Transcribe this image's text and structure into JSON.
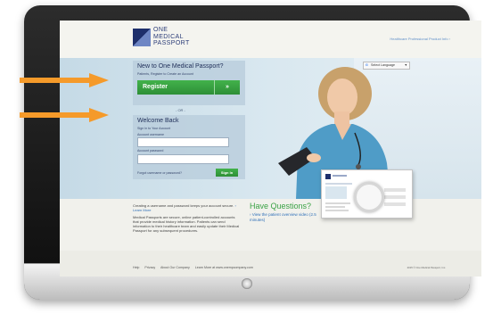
{
  "header": {
    "logo_text": "ONE\nMEDICAL\nPASSPORT",
    "pro_link": "Healthcare Professional Product Info ›"
  },
  "language": {
    "label": "Select Language",
    "caret": "▼",
    "g_icon": "G"
  },
  "new_section": {
    "title": "New to One Medical Passport?",
    "subtitle": "Patients, Register to Create an Account",
    "register_label": "Register",
    "register_chevron": "»"
  },
  "or_label": "- OR -",
  "welcome": {
    "title": "Welcome Back",
    "subtitle": "Sign In to Your Account",
    "username_label": "Account username",
    "password_label": "Account password",
    "forgot": "Forgot username or password?",
    "signin": "Sign In"
  },
  "info": {
    "para1_text": "Creating a username and password keeps your account secure. ",
    "learn_more": "› Learn More",
    "para2": "Medical Passports are secure, online patient-controlled accounts that provide medical history information. Patients can send information to their healthcare team and easily update their Medical Passport for any subsequent procedures."
  },
  "questions": {
    "title": "Have Questions?",
    "link": "› View the patient overview video (2.5 minutes)"
  },
  "footer": {
    "links": [
      "Help",
      "Privacy",
      "About Our Company",
      "Learn More at www.onempcompany.com"
    ],
    "copyright": "2015 © One Medical Passport, Inc."
  },
  "colors": {
    "brand_green": "#3aa245",
    "brand_navy": "#1f2e58",
    "annotation_orange": "#f59a2a"
  },
  "icons": [
    "logo-mark-icon",
    "chevron-double-right-icon",
    "google-translate-icon",
    "annotation-arrow-icon",
    "power-button-icon"
  ]
}
